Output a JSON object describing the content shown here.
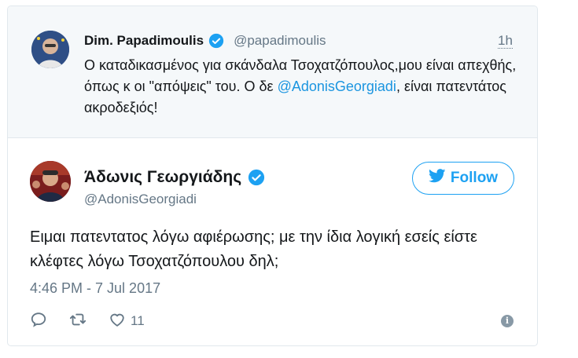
{
  "quoted_tweet": {
    "author_name": "Dim. Papadimoulis",
    "handle": "@papadimoulis",
    "time": "1h",
    "text_before_mention": "Ο καταδικασμένος για σκάνδαλα Τσοχατζόπουλος,μου είναι απεχθής, όπως κ οι \"απόψεις\" του. Ο δε ",
    "mention": "@AdonisGeorgiadi",
    "text_after_mention": ", είναι πατεντάτος ακροδεξιός!"
  },
  "main_tweet": {
    "author_name": "Άδωνις Γεωργιάδης",
    "handle": "@AdonisGeorgiadi",
    "follow_label": "Follow",
    "text": "Ειμαι πατεντατος λόγω αφιέρωσης; με την ίδια λογική εσείς είστε κλέφτες λόγω Τσοχατζόπουλου δηλ;",
    "date": "4:46 PM - 7 Jul 2017",
    "like_count": "11"
  },
  "colors": {
    "accent": "#1da1f2",
    "verified": "#1da1f2",
    "muted": "#657786",
    "quoted_bg": "#f5f8fa"
  },
  "icons": [
    "verified-badge-icon",
    "twitter-bird-icon",
    "reply-icon",
    "retweet-icon",
    "like-icon",
    "info-icon"
  ]
}
